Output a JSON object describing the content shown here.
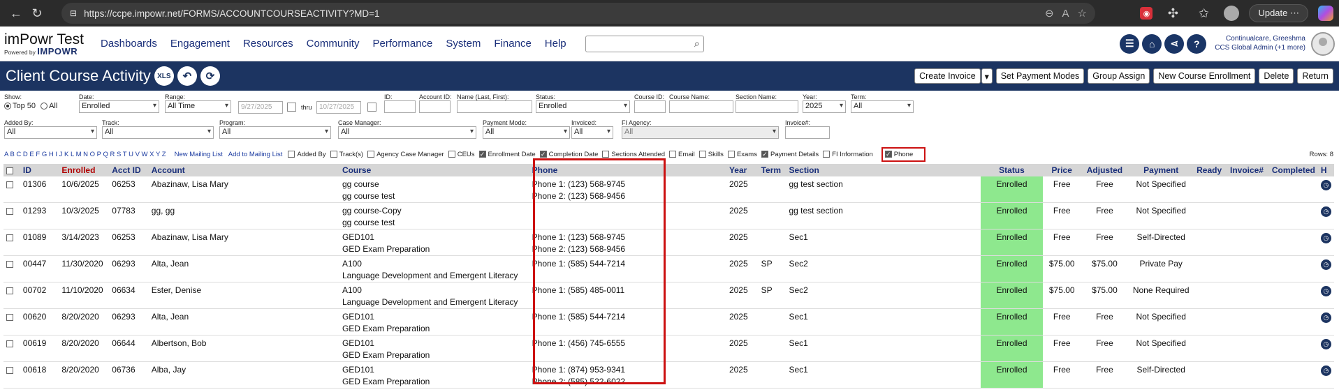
{
  "browser": {
    "url": "https://ccpe.impowr.net/FORMS/ACCOUNTCOURSEACTIVITY?MD=1",
    "update_label": "Update"
  },
  "app": {
    "logo_title": "imPowr Test",
    "logo_powered": "Powered by",
    "logo_brand": "IMPOWR",
    "menu": [
      "Dashboards",
      "Engagement",
      "Resources",
      "Community",
      "Performance",
      "System",
      "Finance",
      "Help"
    ],
    "user_name": "Continualcare, Greeshma",
    "user_role": "CCS Global Admin (+1 more)"
  },
  "page": {
    "title": "Client Course Activity",
    "xls_label": "XLS",
    "buttons": [
      "Create Invoice",
      "Set Payment Modes",
      "Group Assign",
      "New Course Enrollment",
      "Delete",
      "Return"
    ]
  },
  "filters": {
    "show_label": "Show:",
    "top50": "Top 50",
    "all": "All",
    "date_label": "Date:",
    "date_value": "Enrolled",
    "range_label": "Range:",
    "range_value": "All Time",
    "from_date": "9/27/2025",
    "thru": "thru",
    "to_date": "10/27/2025",
    "id_label": "ID:",
    "account_id_label": "Account ID:",
    "name_label": "Name (Last, First):",
    "status_label": "Status:",
    "status_value": "Enrolled",
    "course_id_label": "Course ID:",
    "course_name_label": "Course Name:",
    "section_name_label": "Section Name:",
    "year_label": "Year:",
    "year_value": "2025",
    "term_label": "Term:",
    "term_value": "All",
    "added_by_label": "Added By:",
    "added_by_value": "All",
    "track_label": "Track:",
    "track_value": "All",
    "program_label": "Program:",
    "program_value": "All",
    "case_manager_label": "Case Manager:",
    "case_manager_value": "All",
    "payment_mode_label": "Payment Mode:",
    "payment_mode_value": "All",
    "invoiced_label": "Invoiced:",
    "invoiced_value": "All",
    "fi_agency_label": "FI Agency:",
    "fi_agency_value": "All",
    "invoice_no_label": "Invoice#:"
  },
  "toggles": {
    "alphabet": "A B C D E F G H I J K L M N O P Q R S T U V W X Y Z",
    "new_mailing": "New Mailing List",
    "add_mailing": "Add to Mailing List",
    "items": [
      {
        "label": "Added By",
        "checked": false
      },
      {
        "label": "Track(s)",
        "checked": false
      },
      {
        "label": "Agency Case Manager",
        "checked": false
      },
      {
        "label": "CEUs",
        "checked": false
      },
      {
        "label": "Enrollment Date",
        "checked": true
      },
      {
        "label": "Completion Date",
        "checked": true
      },
      {
        "label": "Sections Attended",
        "checked": false
      },
      {
        "label": "Email",
        "checked": false
      },
      {
        "label": "Skills",
        "checked": false
      },
      {
        "label": "Exams",
        "checked": false
      },
      {
        "label": "Payment Details",
        "checked": true
      },
      {
        "label": "FI Information",
        "checked": false
      }
    ],
    "phone_label": "Phone",
    "rows": "Rows: 8"
  },
  "table": {
    "headers": [
      "ID",
      "Enrolled",
      "Acct ID",
      "Account",
      "Course",
      "Phone",
      "Year",
      "Term",
      "Section",
      "Status",
      "Price",
      "Adjusted",
      "Payment",
      "Ready",
      "Invoice#",
      "Completed",
      "H"
    ],
    "rows": [
      {
        "id": "01306",
        "enrolled": "10/6/2025",
        "acct": "06253",
        "account": "Abazinaw, Lisa Mary",
        "course": "gg course",
        "course2": "gg course test",
        "phone1": "Phone 1: (123) 568-9745",
        "phone2": "Phone 2: (123) 568-9456",
        "year": "2025",
        "term": "",
        "section": "gg test section",
        "status": "Enrolled",
        "price": "Free",
        "adjusted": "Free",
        "payment": "Not Specified"
      },
      {
        "id": "01293",
        "enrolled": "10/3/2025",
        "acct": "07783",
        "account": "gg, gg",
        "course": "gg course-Copy",
        "course2": "gg course test",
        "phone1": "",
        "phone2": "",
        "year": "2025",
        "term": "",
        "section": "gg test section",
        "status": "Enrolled",
        "price": "Free",
        "adjusted": "Free",
        "payment": "Not Specified"
      },
      {
        "id": "01089",
        "enrolled": "3/14/2023",
        "acct": "06253",
        "account": "Abazinaw, Lisa Mary",
        "course": "GED101",
        "course2": "GED Exam Preparation",
        "phone1": "Phone 1: (123) 568-9745",
        "phone2": "Phone 2: (123) 568-9456",
        "year": "2025",
        "term": "",
        "section": "Sec1",
        "status": "Enrolled",
        "price": "Free",
        "adjusted": "Free",
        "payment": "Self-Directed"
      },
      {
        "id": "00447",
        "enrolled": "11/30/2020",
        "acct": "06293",
        "account": "Alta, Jean",
        "course": "A100",
        "course2": "Language Development and Emergent Literacy",
        "phone1": "Phone 1: (585) 544-7214",
        "phone2": "",
        "year": "2025",
        "term": "SP",
        "section": "Sec2",
        "status": "Enrolled",
        "price": "$75.00",
        "adjusted": "$75.00",
        "payment": "Private Pay"
      },
      {
        "id": "00702",
        "enrolled": "11/10/2020",
        "acct": "06634",
        "account": "Ester, Denise",
        "course": "A100",
        "course2": "Language Development and Emergent Literacy",
        "phone1": "Phone 1: (585) 485-0011",
        "phone2": "",
        "year": "2025",
        "term": "SP",
        "section": "Sec2",
        "status": "Enrolled",
        "price": "$75.00",
        "adjusted": "$75.00",
        "payment": "None Required"
      },
      {
        "id": "00620",
        "enrolled": "8/20/2020",
        "acct": "06293",
        "account": "Alta, Jean",
        "course": "GED101",
        "course2": "GED Exam Preparation",
        "phone1": "Phone 1: (585) 544-7214",
        "phone2": "",
        "year": "2025",
        "term": "",
        "section": "Sec1",
        "status": "Enrolled",
        "price": "Free",
        "adjusted": "Free",
        "payment": "Not Specified"
      },
      {
        "id": "00619",
        "enrolled": "8/20/2020",
        "acct": "06644",
        "account": "Albertson, Bob",
        "course": "GED101",
        "course2": "GED Exam Preparation",
        "phone1": "Phone 1: (456) 745-6555",
        "phone2": "",
        "year": "2025",
        "term": "",
        "section": "Sec1",
        "status": "Enrolled",
        "price": "Free",
        "adjusted": "Free",
        "payment": "Not Specified"
      },
      {
        "id": "00618",
        "enrolled": "8/20/2020",
        "acct": "06736",
        "account": "Alba, Jay",
        "course": "GED101",
        "course2": "GED Exam Preparation",
        "phone1": "Phone 1: (874) 953-9341",
        "phone2": "Phone 2: (585) 522-6022",
        "year": "2025",
        "term": "",
        "section": "Sec1",
        "status": "Enrolled",
        "price": "Free",
        "adjusted": "Free",
        "payment": "Self-Directed"
      }
    ]
  },
  "colors": {
    "nav": "#1c3461",
    "status_green": "#8ee88e",
    "highlight": "#cc1111"
  }
}
